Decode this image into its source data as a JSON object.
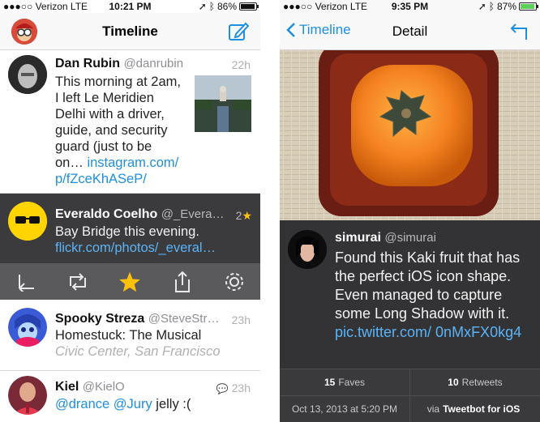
{
  "left": {
    "status": {
      "carrier": "●●●○○ Verizon  LTE",
      "time": "10:21 PM",
      "battery": "86%",
      "battery_level": 0.86
    },
    "nav": {
      "title": "Timeline"
    },
    "tweets": [
      {
        "name": "Dan Rubin",
        "handle": "@danrubin",
        "age": "22h",
        "body_lines": [
          "This morning at 2am,",
          "I left Le Meridien",
          "Delhi with a driver,",
          "guide, and security",
          "guard (just to be"
        ],
        "body_tail": "on…",
        "link": "instagram.com/",
        "link2": "p/fZceKhASeP/"
      },
      {
        "name": "Everaldo Coelho",
        "handle": "@_Evera…",
        "age": "2",
        "body": "Bay Bridge this evening.",
        "link": "flickr.com/photos/_everal…"
      },
      {
        "name": "Spooky Streza",
        "handle": "@SteveStr…",
        "age": "23h",
        "body": "Homestuck: The Musical",
        "location": "Civic Center, San Francisco"
      },
      {
        "name": "Kiel",
        "handle": "@KielO",
        "age": "23h",
        "mention1": "@drance",
        "mention2": "@Jury",
        "body_tail": " jelly :("
      }
    ]
  },
  "right": {
    "status": {
      "carrier": "●●●○○ Verizon  LTE",
      "time": "9:35 PM",
      "battery": "87%",
      "battery_level": 0.87
    },
    "nav": {
      "back_label": "Timeline",
      "title": "Detail"
    },
    "tweet": {
      "name": "simurai",
      "handle": "@simurai",
      "body": "Found this Kaki fruit that has the perfect iOS icon shape. Even managed to capture some Long Shadow with it.",
      "link": "pic.twitter.com/",
      "link2": "0nMxFX0kg4"
    },
    "stats": {
      "faves_count": "15",
      "faves_label": "Faves",
      "retweets_count": "10",
      "retweets_label": "Retweets",
      "date": "Oct 13, 2013 at 5:20 PM",
      "via_prefix": "via",
      "via_app": "Tweetbot for iOS"
    }
  },
  "colors": {
    "accent": "#1e8fe1",
    "star": "#ffc107",
    "dark_row": "#3b3b3d"
  }
}
